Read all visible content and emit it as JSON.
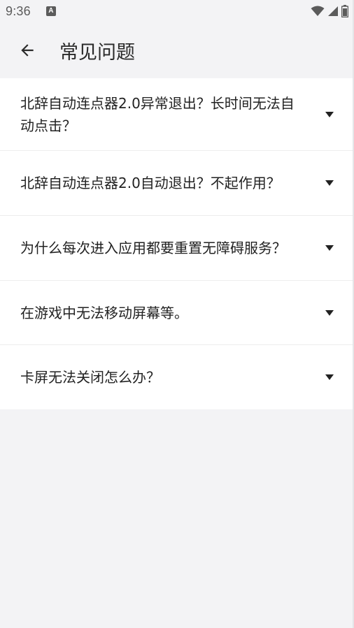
{
  "status_bar": {
    "time": "9:36",
    "notification_icon": "accessibility-a-icon",
    "icons": [
      "wifi-icon",
      "cellular-signal-icon",
      "battery-icon"
    ]
  },
  "app_bar": {
    "back_icon": "arrow-left-icon",
    "title": "常见问题"
  },
  "faq": [
    {
      "question": "北辞自动连点器2.0异常退出？长时间无法自动点击？",
      "icon": "caret-down-icon"
    },
    {
      "question": "北辞自动连点器2.0自动退出？不起作用？",
      "icon": "caret-down-icon"
    },
    {
      "question": "为什么每次进入应用都要重置无障碍服务？",
      "icon": "caret-down-icon"
    },
    {
      "question": "在游戏中无法移动屏幕等。",
      "icon": "caret-down-icon"
    },
    {
      "question": "卡屏无法关闭怎么办？",
      "icon": "caret-down-icon"
    }
  ],
  "colors": {
    "background": "#f3f3f5",
    "card": "#ffffff",
    "text": "#222222",
    "status": "#5b5b5b"
  }
}
